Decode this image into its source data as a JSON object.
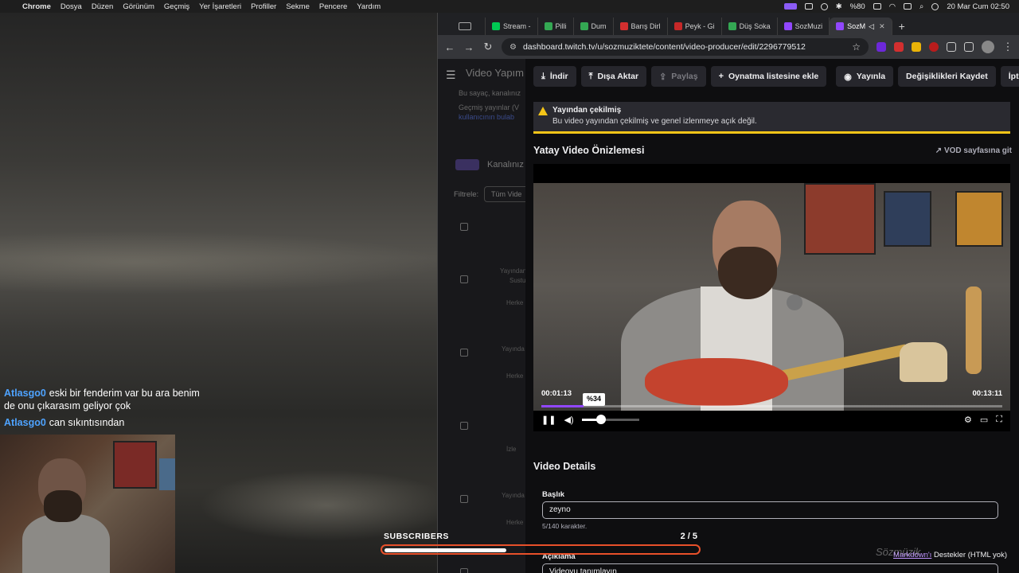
{
  "menubar": {
    "app": "Chrome",
    "items": [
      "Dosya",
      "Düzen",
      "Görünüm",
      "Geçmiş",
      "Yer İşaretleri",
      "Profiller",
      "Sekme",
      "Pencere",
      "Yardım"
    ],
    "battery": "%80",
    "datetime": "20 Mar Cum  02:50"
  },
  "chat": [
    {
      "user": "Atlasgo0",
      "text": "eski bir fenderim var bu ara benim de onu çıkarasım geliyor çok"
    },
    {
      "user": "Atlasgo0",
      "text": "can sıkıntısından"
    }
  ],
  "subscribers": {
    "label": "SUBSCRIBERS",
    "count": "2  / 5",
    "progress": 0.4
  },
  "browser": {
    "tabs": [
      {
        "title": "Stream -",
        "color": "#00c853",
        "icon": "K"
      },
      {
        "title": "Pilli",
        "color": "#34a853",
        "icon": "P"
      },
      {
        "title": "Dum",
        "color": "#34a853",
        "icon": "D"
      },
      {
        "title": "Barış Dirl",
        "color": "#d32f2f",
        "icon": "A"
      },
      {
        "title": "Peyk - Gi",
        "color": "#c62828",
        "icon": "Y"
      },
      {
        "title": "Düş Soka",
        "color": "#34a853",
        "icon": "D"
      },
      {
        "title": "SozMuzi",
        "color": "#9147ff",
        "icon": "T"
      },
      {
        "title": "SozM",
        "color": "#9147ff",
        "icon": "T"
      }
    ],
    "url": "dashboard.twitch.tv/u/sozmuziktete/content/video-producer/edit/2296779512"
  },
  "dashboard": {
    "title": "Video Yapım",
    "desc1": "Bu sayaç, kanalınız",
    "desc2": "Geçmiş yayınlar (V",
    "desc3": "kullanıcının bulab",
    "kanal": "Kanalınız",
    "filter_label": "Filtrele:",
    "filter_value": "Tüm Vide",
    "row1a": "Yayından",
    "row1b": "Sustu",
    "herkes": "Herke",
    "row2a": "Yayında",
    "play": "İzle"
  },
  "producer": {
    "actions": {
      "download": "İndir",
      "export": "Dışa Aktar",
      "share": "Paylaş",
      "playlist": "Oynatma listesine ekle",
      "publish": "Yayınla",
      "save": "Değişiklikleri Kaydet",
      "cancel": "İptal"
    },
    "warning": {
      "title": "Yayından çekilmiş",
      "text": "Bu video yayından çekilmiş ve genel izlenmeye açık değil."
    },
    "preview_title": "Yatay Video Önizlemesi",
    "vod_link": "VOD sayfasına git",
    "player": {
      "current": "00:01:13",
      "total": "00:13:11",
      "progress": 0.092,
      "volume_label": "%34",
      "volume": 0.34
    },
    "details_title": "Video Details",
    "title_label": "Başlık",
    "title_value": "zeyno",
    "title_hint": "5/140 karakter.",
    "desc_label": "Açıklama",
    "markdown_link": "Markdown'ı",
    "markdown_rest": " Destekler (HTML yok)",
    "desc_placeholder": "Videoyu tanımlayın"
  },
  "watermark": "Sözmüzik"
}
